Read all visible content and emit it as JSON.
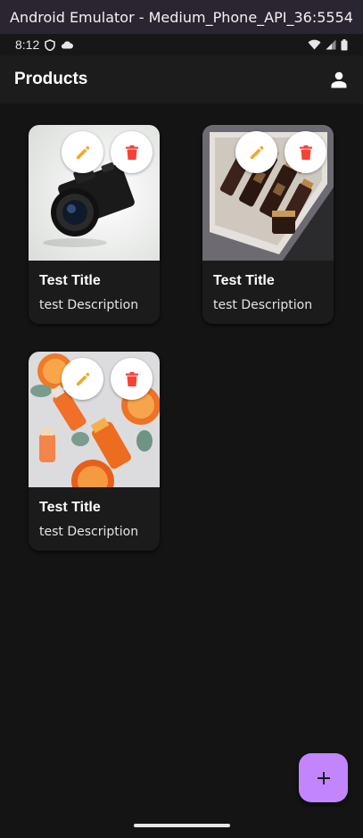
{
  "window": {
    "title": "Android Emulator - Medium_Phone_API_36:5554"
  },
  "statusbar": {
    "time": "8:12"
  },
  "appbar": {
    "title": "Products"
  },
  "products": [
    {
      "title": "Test Title",
      "description": "test Description",
      "image": "camera-photo"
    },
    {
      "title": "Test Title",
      "description": "test Description",
      "image": "cosmetics-box-photo"
    },
    {
      "title": "Test Title",
      "description": "test Description",
      "image": "orange-skincare-photo"
    }
  ],
  "colors": {
    "edit": "#f5a623",
    "delete": "#f44336",
    "fab": "#c385fb",
    "background": "#141414"
  },
  "icons": {
    "edit": "pencil-icon",
    "delete": "trash-icon",
    "add": "plus-icon",
    "profile": "person-icon"
  }
}
